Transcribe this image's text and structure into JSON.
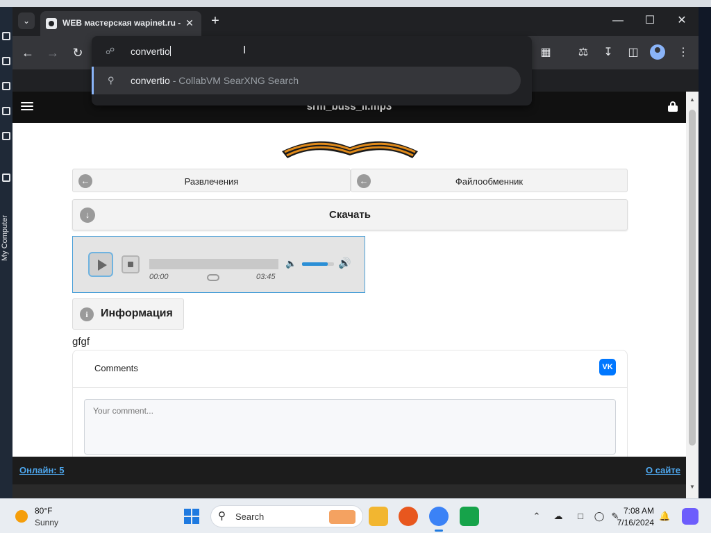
{
  "browser": {
    "tab": {
      "title": "WEB мастерская wapinet.ru -"
    },
    "omnibox": {
      "query": "convertio",
      "suggestion_text": "convertio",
      "suggestion_meta": " - CollabVM SearXNG Search"
    }
  },
  "page": {
    "title": "srm_buss_ii.mp3",
    "nav": [
      {
        "label": "Развлечения"
      },
      {
        "label": "Файлообменник"
      }
    ],
    "download_label": "Скачать",
    "player": {
      "current_time": "00:00",
      "duration": "03:45",
      "volume_level": 0.8
    },
    "info_label": "Информация",
    "description": "gfgf",
    "comments": {
      "title": "Comments",
      "placeholder": "Your comment...",
      "vk_badge": "VK"
    },
    "footer": {
      "online": "Онлайн: 5",
      "about": "О сайте"
    }
  },
  "desktop": {
    "sidebar_label": "My Computer"
  },
  "taskbar": {
    "weather_temp": "80°F",
    "weather_condition": "Sunny",
    "search_label": "Search",
    "time": "7:08 AM",
    "date": "7/16/2024"
  },
  "colors": {
    "accent": "#4a9fd8",
    "link": "#4ea8ef",
    "vk": "#0077ff"
  }
}
